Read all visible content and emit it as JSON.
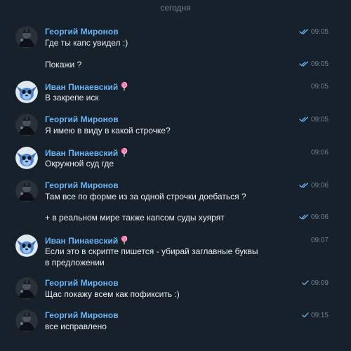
{
  "date_separator": "сегодня",
  "messages": [
    {
      "author": "Георгий Миронов",
      "text": "Где ты капс увидел :)",
      "time": "09:05",
      "status": "read"
    },
    {
      "author": "",
      "text": "Покажи ?",
      "time": "09:05",
      "status": "read"
    },
    {
      "author": "Иван Пинаевский",
      "text": "В закрепе иск",
      "time": "09:05",
      "status": ""
    },
    {
      "author": "Георгий Миронов",
      "text": "Я имею в виду в какой строчке?",
      "time": "09:05",
      "status": "read"
    },
    {
      "author": "Иван Пинаевский",
      "text": "Окружной суд где",
      "time": "09:06",
      "status": ""
    },
    {
      "author": "Георгий Миронов",
      "text": "Там все по форме из за одной строчки доебаться ?",
      "time": "09:06",
      "status": "read"
    },
    {
      "author": "",
      "text": "+ в реальном мире также капсом суды хуярят",
      "time": "09:06",
      "status": "read"
    },
    {
      "author": "Иван Пинаевский",
      "text": "Если это в скрипте пишется - убирай заглавные буквы в предложении",
      "time": "09:07",
      "status": ""
    },
    {
      "author": "Георгий Миронов",
      "text": "Щас покажу всем как пофиксить :)",
      "time": "09:09",
      "status": "sent"
    },
    {
      "author": "Георгий Миронов",
      "text": "все исправлено",
      "time": "09:15",
      "status": "sent"
    }
  ],
  "icons": {
    "read": "double-check-icon",
    "sent": "single-check-icon",
    "author_badge": "lollipop-emoji-icon"
  },
  "colors": {
    "background": "#17212b",
    "author_name": "#6ab3f3",
    "message_text": "#e9eef2",
    "meta": "#6d7f8f",
    "check": "#6ab3f3"
  }
}
